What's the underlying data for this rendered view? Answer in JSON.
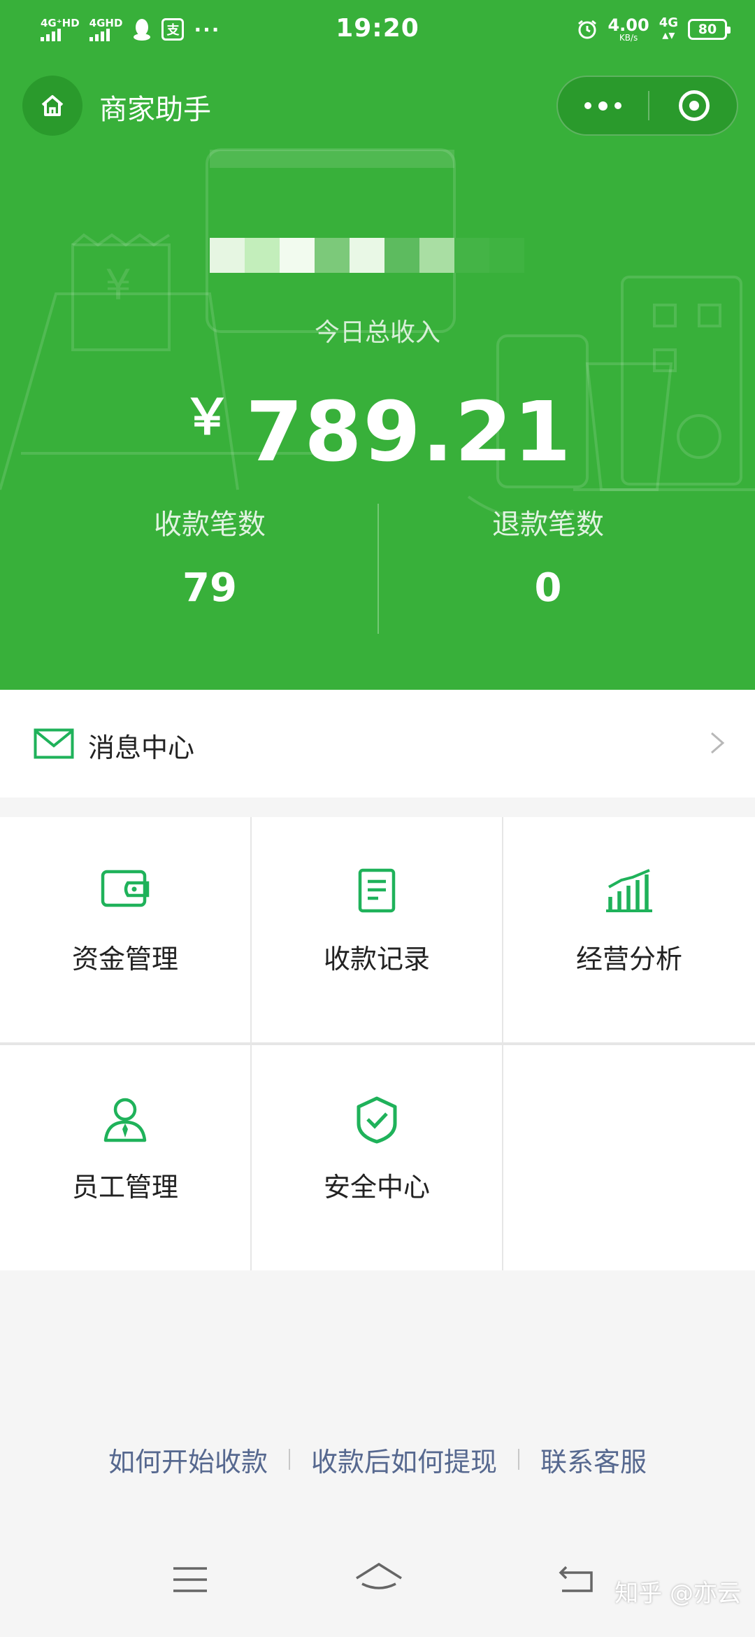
{
  "status_bar": {
    "signal1_label": "4G⁺HD",
    "signal2_label": "4GHD",
    "app_icon_glyph": "支",
    "more_dots": "···",
    "time": "19:20",
    "net_speed_value": "4.00",
    "net_speed_unit": "KB/s",
    "signal3_label": "4G",
    "battery": "80"
  },
  "nav": {
    "title": "商家助手"
  },
  "summary": {
    "income_label": "今日总收入",
    "currency": "￥",
    "income_amount": "789.21",
    "payments_label": "收款笔数",
    "payments_count": "79",
    "refunds_label": "退款笔数",
    "refunds_count": "0"
  },
  "message_center": {
    "label": "消息中心"
  },
  "grid": {
    "items": [
      {
        "label": "资金管理",
        "icon": "wallet-icon"
      },
      {
        "label": "收款记录",
        "icon": "document-icon"
      },
      {
        "label": "经营分析",
        "icon": "bar-chart-icon"
      },
      {
        "label": "员工管理",
        "icon": "staff-icon"
      },
      {
        "label": "安全中心",
        "icon": "shield-check-icon"
      }
    ]
  },
  "footer_links": {
    "link1": "如何开始收款",
    "link2": "收款后如何提现",
    "link3": "联系客服"
  },
  "watermark": "知乎 @亦云",
  "colors": {
    "brand_green": "#38b03a",
    "icon_green": "#1fb25a",
    "link_blue": "#56688f"
  }
}
